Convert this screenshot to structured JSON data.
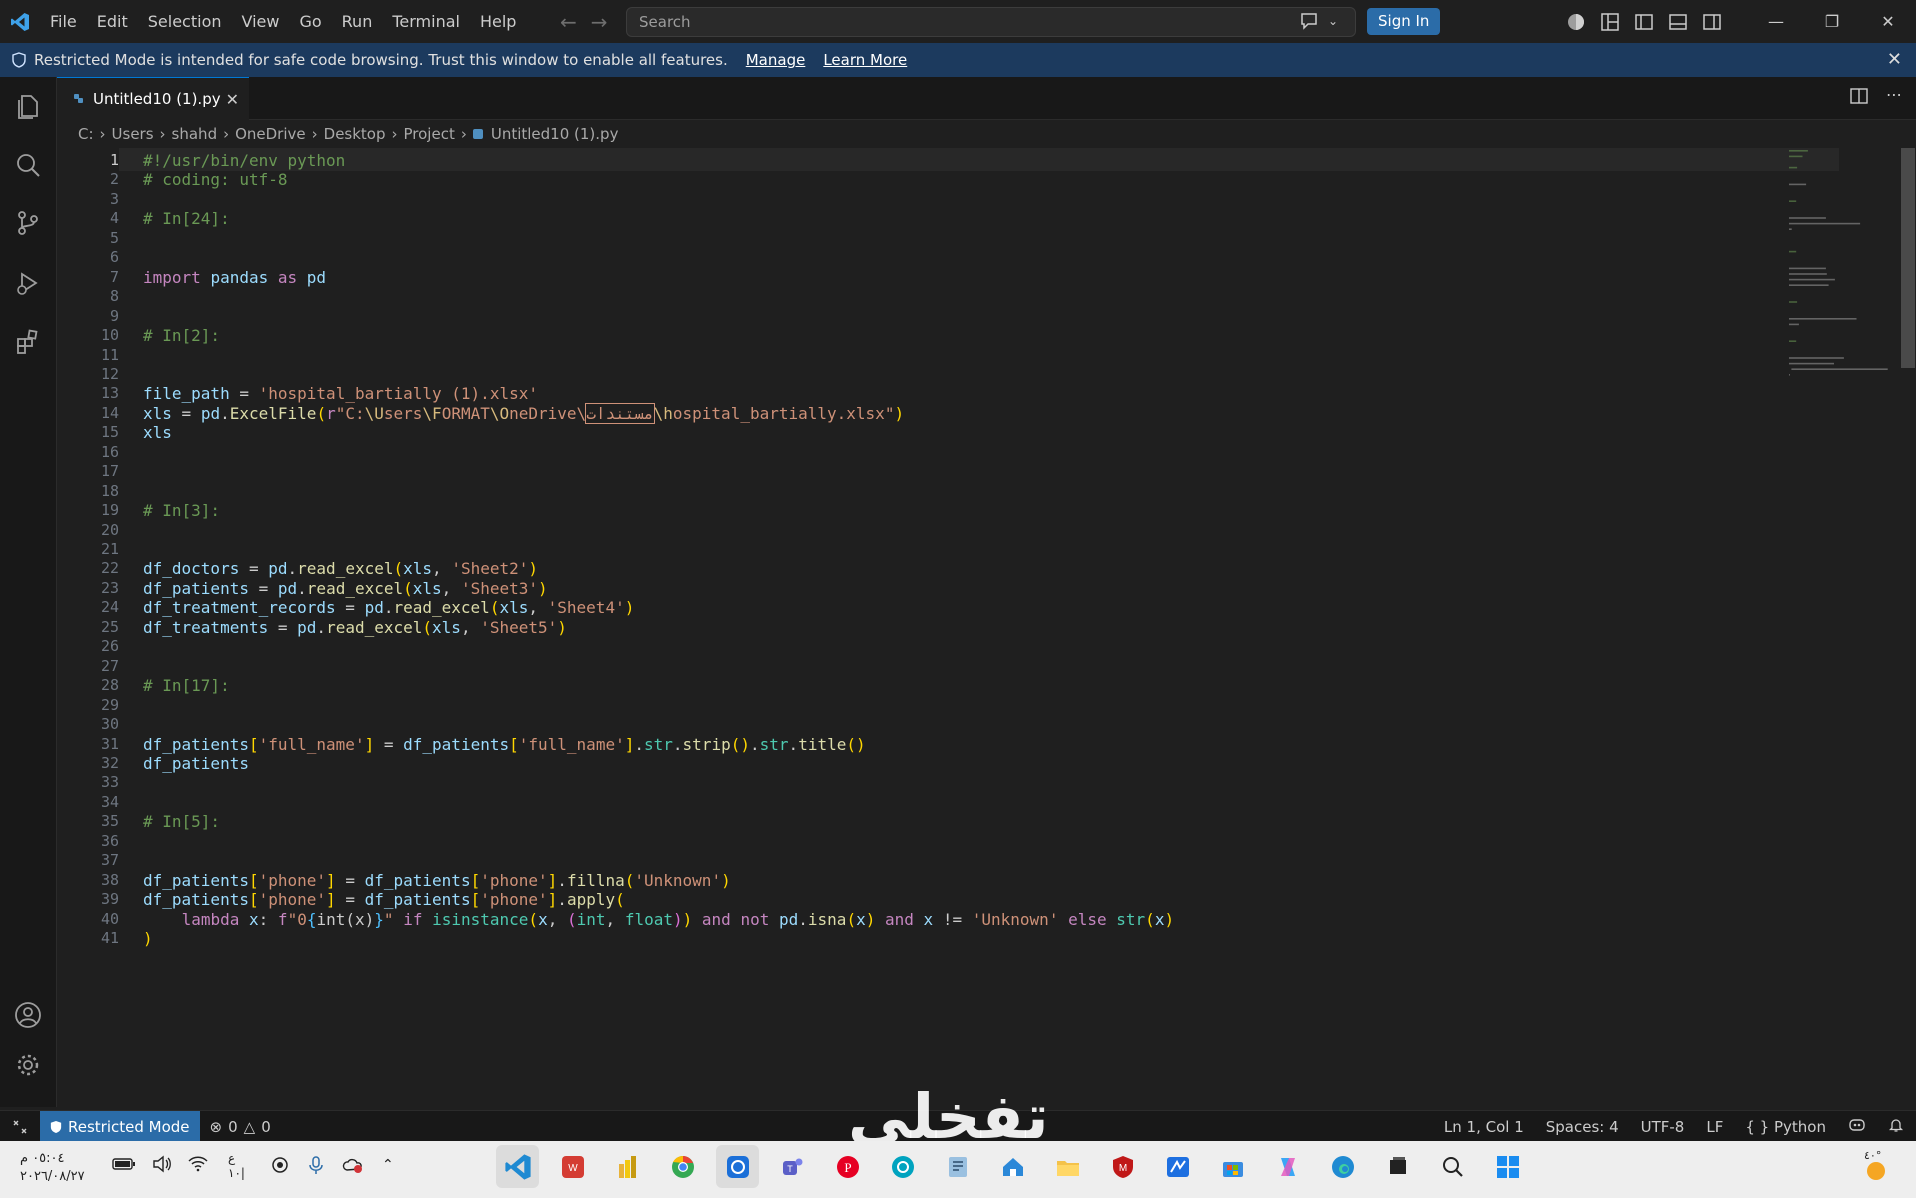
{
  "menu": [
    "File",
    "Edit",
    "Selection",
    "View",
    "Go",
    "Run",
    "Terminal",
    "Help"
  ],
  "search_placeholder": "Search",
  "signin_label": "Sign In",
  "banner": {
    "text": "Restricted Mode is intended for safe code browsing. Trust this window to enable all features.",
    "manage": "Manage",
    "learn_more": "Learn More"
  },
  "tab": {
    "label": "Untitled10 (1).py"
  },
  "breadcrumb": [
    "C:",
    "Users",
    "shahd",
    "OneDrive",
    "Desktop",
    "Project",
    "Untitled10 (1).py"
  ],
  "editor": {
    "active_line": 1,
    "lines": [
      {
        "n": 1,
        "t": "#!/usr/bin/env python"
      },
      {
        "n": 2,
        "t": "# coding: utf-8"
      },
      {
        "n": 3,
        "t": ""
      },
      {
        "n": 4,
        "t": "# In[24]:"
      },
      {
        "n": 5,
        "t": ""
      },
      {
        "n": 6,
        "t": ""
      },
      {
        "n": 7,
        "t": "import pandas as pd"
      },
      {
        "n": 8,
        "t": ""
      },
      {
        "n": 9,
        "t": ""
      },
      {
        "n": 10,
        "t": "# In[2]:"
      },
      {
        "n": 11,
        "t": ""
      },
      {
        "n": 12,
        "t": ""
      },
      {
        "n": 13,
        "t": "file_path = 'hospital_bartially (1).xlsx'"
      },
      {
        "n": 14,
        "t": "xls = pd.ExcelFile(r\"C:\\Users\\FORMAT\\OneDrive\\مستندات\\hospital_bartially.xlsx\")"
      },
      {
        "n": 15,
        "t": "xls"
      },
      {
        "n": 16,
        "t": ""
      },
      {
        "n": 17,
        "t": ""
      },
      {
        "n": 18,
        "t": ""
      },
      {
        "n": 19,
        "t": "# In[3]:"
      },
      {
        "n": 20,
        "t": ""
      },
      {
        "n": 21,
        "t": ""
      },
      {
        "n": 22,
        "t": "df_doctors = pd.read_excel(xls, 'Sheet2')"
      },
      {
        "n": 23,
        "t": "df_patients = pd.read_excel(xls, 'Sheet3')"
      },
      {
        "n": 24,
        "t": "df_treatment_records = pd.read_excel(xls, 'Sheet4')"
      },
      {
        "n": 25,
        "t": "df_treatments = pd.read_excel(xls, 'Sheet5')"
      },
      {
        "n": 26,
        "t": ""
      },
      {
        "n": 27,
        "t": ""
      },
      {
        "n": 28,
        "t": "# In[17]:"
      },
      {
        "n": 29,
        "t": ""
      },
      {
        "n": 30,
        "t": ""
      },
      {
        "n": 31,
        "t": "df_patients['full_name'] = df_patients['full_name'].str.strip().str.title()"
      },
      {
        "n": 32,
        "t": "df_patients"
      },
      {
        "n": 33,
        "t": ""
      },
      {
        "n": 34,
        "t": ""
      },
      {
        "n": 35,
        "t": "# In[5]:"
      },
      {
        "n": 36,
        "t": ""
      },
      {
        "n": 37,
        "t": ""
      },
      {
        "n": 38,
        "t": "df_patients['phone'] = df_patients['phone'].fillna('Unknown')"
      },
      {
        "n": 39,
        "t": "df_patients['phone'] = df_patients['phone'].apply("
      },
      {
        "n": 40,
        "t": "    lambda x: f\"0{int(x)}\" if isinstance(x, (int, float)) and not pd.isna(x) and x != 'Unknown' else str(x)"
      },
      {
        "n": 41,
        "t": ")"
      }
    ]
  },
  "status": {
    "restricted": "Restricted Mode",
    "errors": "0",
    "warnings": "0",
    "position": "Ln 1, Col 1",
    "spaces": "Spaces: 4",
    "encoding": "UTF-8",
    "eol": "LF",
    "language": "Python"
  },
  "taskbar": {
    "time": "٠٥:٠٤ م",
    "date": "٢٠٢٦/٠٨/٢٧",
    "lang": "ع",
    "lang2": "١٠|",
    "weather": "٤٠°"
  },
  "watermark": "تفخلي",
  "colors": {
    "accent": "#0078d4",
    "signin": "#2b6ca8",
    "banner": "#1c3a5e"
  }
}
